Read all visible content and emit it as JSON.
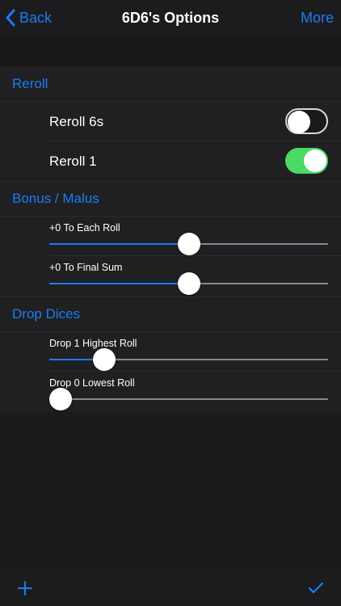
{
  "nav": {
    "back_label": "Back",
    "title": "6D6's Options",
    "more_label": "More"
  },
  "sections": {
    "reroll": {
      "header": "Reroll",
      "rows": [
        {
          "label": "Reroll 6s",
          "on": false
        },
        {
          "label": "Reroll 1",
          "on": true
        }
      ]
    },
    "bonus": {
      "header": "Bonus / Malus",
      "sliders": [
        {
          "label": "+0 To Each Roll",
          "value": 0.5
        },
        {
          "label": "+0 To Final Sum",
          "value": 0.5
        }
      ]
    },
    "drop": {
      "header": "Drop Dices",
      "sliders": [
        {
          "label": "Drop 1 Highest Roll",
          "value": 0.17
        },
        {
          "label": "Drop 0 Lowest Roll",
          "value": 0.0
        }
      ]
    }
  },
  "toolbar": {
    "add_icon": "plus-icon",
    "confirm_icon": "checkmark-icon"
  },
  "colors": {
    "accent": "#1a7cf5",
    "switch_on": "#4cd964",
    "background": "#1b1b1d"
  }
}
